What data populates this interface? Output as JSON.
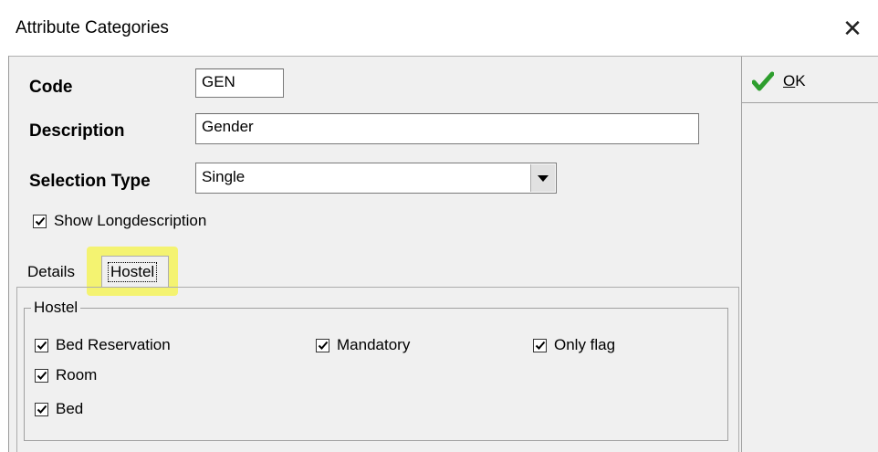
{
  "window": {
    "title": "Attribute Categories",
    "close_glyph": "✕"
  },
  "form": {
    "code_label": "Code",
    "code_value": "GEN",
    "description_label": "Description",
    "description_value": "Gender",
    "selection_type_label": "Selection Type",
    "selection_type_value": "Single",
    "show_long_label": "Show Longdescription",
    "show_long_checked": true
  },
  "toolbar": {
    "ok_label": "OK",
    "ok_mnemonic": "O",
    "ok_rest": "K"
  },
  "tabs": [
    {
      "label": "Details",
      "active": false
    },
    {
      "label": "Hostel",
      "active": true
    }
  ],
  "hostel_group": {
    "title": "Hostel",
    "checkboxes": [
      {
        "label": "Bed Reservation",
        "checked": true
      },
      {
        "label": "Mandatory",
        "checked": true
      },
      {
        "label": "Only flag",
        "checked": true
      },
      {
        "label": "Room",
        "checked": true
      },
      {
        "label": "Bed",
        "checked": true
      }
    ]
  },
  "colors": {
    "highlight": "#f4f35a",
    "ok_check": "#2e9e2e",
    "window_bg": "#f0f0f0"
  }
}
